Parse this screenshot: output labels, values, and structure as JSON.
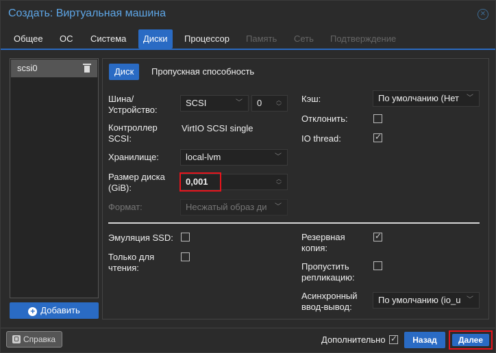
{
  "window": {
    "title": "Создать: Виртуальная машина"
  },
  "tabs": [
    {
      "label": "Общее",
      "state": "normal"
    },
    {
      "label": "ОС",
      "state": "normal"
    },
    {
      "label": "Система",
      "state": "normal"
    },
    {
      "label": "Диски",
      "state": "active"
    },
    {
      "label": "Процессор",
      "state": "normal"
    },
    {
      "label": "Память",
      "state": "disabled"
    },
    {
      "label": "Сеть",
      "state": "disabled"
    },
    {
      "label": "Подтверждение",
      "state": "disabled"
    }
  ],
  "disk_list": {
    "items": [
      {
        "label": "scsi0"
      }
    ],
    "add_label": "Добавить"
  },
  "subtabs": [
    {
      "label": "Диск",
      "state": "active"
    },
    {
      "label": "Пропускная способность",
      "state": "normal"
    }
  ],
  "form": {
    "bus_label": "Шина/\nУстройство:",
    "bus_value": "SCSI",
    "device_value": "0",
    "controller_label": "Контроллер\nSCSI:",
    "controller_value": "VirtIO SCSI single",
    "storage_label": "Хранилище:",
    "storage_value": "local-lvm",
    "size_label": "Размер диска\n(GiB):",
    "size_value": "0,001",
    "format_label": "Формат:",
    "format_value": "Несжатый образ ди",
    "cache_label": "Кэш:",
    "cache_value": "По умолчанию (Нет",
    "discard_label": "Отклонить:",
    "discard_checked": false,
    "iothread_label": "IO thread:",
    "iothread_checked": true,
    "ssd_label": "Эмуляция SSD:",
    "ssd_checked": false,
    "readonly_label": "Только для\nчтения:",
    "readonly_checked": false,
    "backup_label": "Резервная\nкопия:",
    "backup_checked": true,
    "skip_repl_label": "Пропустить\nрепликацию:",
    "skip_repl_checked": false,
    "async_label": "Асинхронный\nввод-вывод:",
    "async_value": "По умолчанию (io_u"
  },
  "footer": {
    "help_label": "Справка",
    "advanced_label": "Дополнительно",
    "advanced_checked": true,
    "back_label": "Назад",
    "next_label": "Далее"
  },
  "colors": {
    "accent": "#2a6bc4",
    "title": "#5ea6e6",
    "highlight": "#e8141c"
  }
}
